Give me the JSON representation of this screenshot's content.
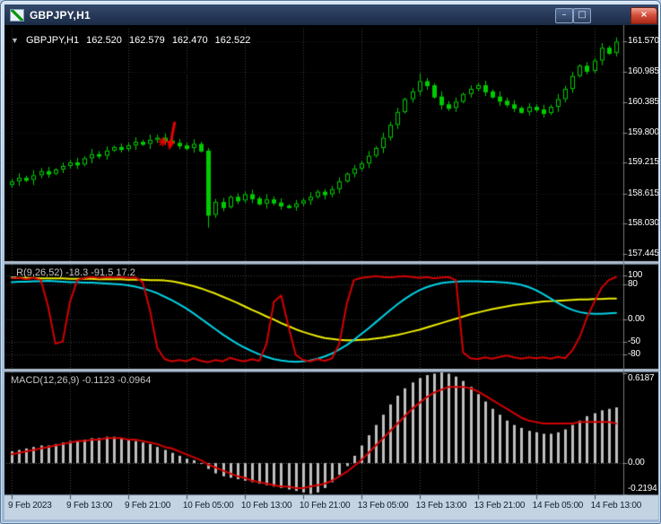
{
  "window": {
    "title": "GBPJPY,H1",
    "controls": {
      "minimize": "–",
      "restore": "□",
      "close": "×"
    }
  },
  "info_line": {
    "marker": "▼",
    "symbol": "GBPJPY,H1",
    "open": "162.520",
    "high": "162.579",
    "low": "162.470",
    "close": "162.522"
  },
  "oscillator": {
    "label": "_R(9,26,52) -18.3 -91.5 17.2"
  },
  "macd": {
    "label": "MACD(12,26,9) -0.1123 -0.0964"
  },
  "colors": {
    "bull": "#00CC00",
    "bear": "#00CC00",
    "osc_red": "#D40000",
    "osc_cyan": "#00D2E6",
    "osc_yellow": "#EDED00",
    "hist": "#BEBEBE",
    "signal": "#D40000",
    "annotation": "#E60000",
    "axis_text": "#FFFFFF",
    "time_text": "#10202F"
  },
  "annotations": [
    {
      "type": "arrow-down",
      "bar": 22,
      "from_price": 159.99,
      "to_price": 159.46
    },
    {
      "type": "star",
      "bar": 21,
      "price": 159.62
    }
  ],
  "chart_data": [
    {
      "type": "candlestick",
      "title": "GBPJPY,H1",
      "y_range": [
        157.3,
        161.82
      ],
      "y_ticks": [
        "161.570",
        "160.985",
        "160.385",
        "159.800",
        "159.215",
        "158.615",
        "158.030",
        "157.445"
      ],
      "x_labels": [
        [
          0,
          "9 Feb 2023"
        ],
        [
          8,
          "9 Feb 13:00"
        ],
        [
          16,
          "9 Feb 21:00"
        ],
        [
          24,
          "10 Feb 05:00"
        ],
        [
          32,
          "10 Feb 13:00"
        ],
        [
          40,
          "10 Feb 21:00"
        ],
        [
          48,
          "13 Feb 05:00"
        ],
        [
          56,
          "13 Feb 13:00"
        ],
        [
          64,
          "13 Feb 21:00"
        ],
        [
          72,
          "14 Feb 05:00"
        ],
        [
          80,
          "14 Feb 13:00"
        ]
      ],
      "ohlc": [
        [
          158.78,
          158.9,
          158.73,
          158.85
        ],
        [
          158.85,
          159.01,
          158.76,
          158.92
        ],
        [
          158.92,
          158.96,
          158.84,
          158.88
        ],
        [
          158.88,
          159.07,
          158.78,
          158.97
        ],
        [
          158.97,
          159.11,
          158.91,
          159.05
        ],
        [
          159.05,
          159.13,
          158.92,
          159.0
        ],
        [
          159.0,
          159.11,
          158.97,
          159.08
        ],
        [
          159.08,
          159.22,
          159.01,
          159.15
        ],
        [
          159.15,
          159.27,
          159.1,
          159.22
        ],
        [
          159.22,
          159.31,
          159.09,
          159.18
        ],
        [
          159.18,
          159.34,
          159.14,
          159.3
        ],
        [
          159.3,
          159.48,
          159.2,
          159.38
        ],
        [
          159.38,
          159.44,
          159.29,
          159.35
        ],
        [
          159.35,
          159.53,
          159.27,
          159.45
        ],
        [
          159.45,
          159.55,
          159.42,
          159.52
        ],
        [
          159.52,
          159.59,
          159.41,
          159.48
        ],
        [
          159.48,
          159.6,
          159.43,
          159.55
        ],
        [
          159.55,
          159.71,
          159.46,
          159.62
        ],
        [
          159.62,
          159.66,
          159.54,
          159.58
        ],
        [
          159.58,
          159.76,
          159.48,
          159.66
        ],
        [
          159.66,
          159.76,
          159.6,
          159.7
        ],
        [
          159.7,
          159.78,
          159.56,
          159.64
        ],
        [
          159.64,
          159.67,
          159.57,
          159.6
        ],
        [
          159.6,
          159.67,
          159.48,
          159.55
        ],
        [
          159.55,
          159.6,
          159.45,
          159.5
        ],
        [
          159.5,
          159.67,
          159.41,
          159.58
        ],
        [
          159.58,
          159.62,
          159.41,
          159.45
        ],
        [
          159.45,
          159.5,
          157.95,
          158.2
        ],
        [
          158.2,
          158.51,
          158.14,
          158.45
        ],
        [
          158.45,
          158.53,
          158.27,
          158.35
        ],
        [
          158.35,
          158.58,
          158.32,
          158.55
        ],
        [
          158.55,
          158.62,
          158.41,
          158.48
        ],
        [
          158.48,
          158.65,
          158.43,
          158.6
        ],
        [
          158.6,
          158.69,
          158.43,
          158.52
        ],
        [
          158.52,
          158.56,
          158.38,
          158.42
        ],
        [
          158.42,
          158.6,
          158.32,
          158.5
        ],
        [
          158.5,
          158.56,
          158.38,
          158.44
        ],
        [
          158.44,
          158.52,
          158.3,
          158.38
        ],
        [
          158.38,
          158.41,
          158.32,
          158.35
        ],
        [
          158.35,
          158.49,
          158.28,
          158.42
        ],
        [
          158.42,
          158.53,
          158.37,
          158.48
        ],
        [
          158.48,
          158.64,
          158.39,
          158.55
        ],
        [
          158.55,
          158.69,
          158.51,
          158.65
        ],
        [
          158.65,
          158.7,
          158.5,
          158.6
        ],
        [
          158.6,
          158.76,
          158.54,
          158.7
        ],
        [
          158.7,
          158.93,
          158.62,
          158.85
        ],
        [
          158.85,
          159.03,
          158.82,
          159.0
        ],
        [
          159.0,
          159.17,
          158.93,
          159.1
        ],
        [
          159.1,
          159.25,
          159.05,
          159.2
        ],
        [
          159.2,
          159.44,
          159.11,
          159.35
        ],
        [
          159.35,
          159.54,
          159.31,
          159.5
        ],
        [
          159.5,
          159.8,
          159.4,
          159.7
        ],
        [
          159.7,
          160.01,
          159.64,
          159.95
        ],
        [
          159.95,
          160.28,
          159.87,
          160.2
        ],
        [
          160.2,
          160.48,
          160.17,
          160.45
        ],
        [
          160.45,
          160.67,
          160.38,
          160.6
        ],
        [
          160.6,
          160.95,
          160.52,
          160.8
        ],
        [
          160.8,
          160.86,
          160.63,
          160.72
        ],
        [
          160.72,
          160.76,
          160.46,
          160.5
        ],
        [
          160.5,
          160.6,
          160.25,
          160.35
        ],
        [
          160.35,
          160.41,
          160.22,
          160.28
        ],
        [
          160.28,
          160.48,
          160.2,
          160.4
        ],
        [
          160.4,
          160.58,
          160.37,
          160.55
        ],
        [
          160.55,
          160.72,
          160.48,
          160.65
        ],
        [
          160.65,
          160.77,
          160.6,
          160.72
        ],
        [
          160.72,
          160.81,
          160.51,
          160.6
        ],
        [
          160.6,
          160.64,
          160.46,
          160.5
        ],
        [
          160.5,
          160.6,
          160.32,
          160.42
        ],
        [
          160.42,
          160.48,
          160.29,
          160.35
        ],
        [
          160.35,
          160.43,
          160.2,
          160.28
        ],
        [
          160.28,
          160.31,
          160.17,
          160.2
        ],
        [
          160.2,
          160.37,
          160.13,
          160.3
        ],
        [
          160.3,
          160.35,
          160.2,
          160.25
        ],
        [
          160.25,
          160.34,
          160.09,
          160.18
        ],
        [
          160.18,
          160.34,
          160.14,
          160.3
        ],
        [
          160.3,
          160.55,
          160.2,
          160.45
        ],
        [
          160.45,
          160.71,
          160.39,
          160.65
        ],
        [
          160.65,
          160.98,
          160.57,
          160.9
        ],
        [
          160.9,
          161.13,
          160.87,
          161.1
        ],
        [
          161.1,
          161.17,
          160.93,
          161.0
        ],
        [
          161.0,
          161.25,
          160.95,
          161.2
        ],
        [
          161.2,
          161.54,
          161.11,
          161.45
        ],
        [
          161.45,
          161.49,
          161.31,
          161.35
        ],
        [
          161.35,
          161.65,
          161.28,
          161.57
        ]
      ]
    },
    {
      "type": "line",
      "title": "_R(9,26,52)",
      "y_range": [
        -112,
        125
      ],
      "y_ticks": [
        "100",
        "80",
        "0.00",
        "-50",
        "-80"
      ],
      "series": [
        {
          "name": "fast",
          "color_key": "osc_red",
          "values": [
            95,
            95,
            92,
            95,
            90,
            30,
            -55,
            -50,
            40,
            90,
            95,
            97,
            95,
            97,
            96,
            97,
            95,
            96,
            85,
            20,
            -65,
            -90,
            -95,
            -92,
            -95,
            -88,
            -94,
            -97,
            -92,
            -95,
            -87,
            -92,
            -95,
            -90,
            -94,
            -55,
            40,
            55,
            -15,
            -80,
            -92,
            -95,
            -90,
            -94,
            -88,
            -55,
            35,
            90,
            95,
            97,
            99,
            97,
            96,
            98,
            99,
            97,
            95,
            97,
            94,
            96,
            97,
            90,
            -75,
            -88,
            -90,
            -86,
            -89,
            -85,
            -82,
            -86,
            -89,
            -86,
            -88,
            -86,
            -89,
            -85,
            -88,
            -70,
            -40,
            5,
            40,
            72,
            90,
            97
          ]
        },
        {
          "name": "mid",
          "color_key": "osc_cyan",
          "values": [
            85,
            86,
            86,
            87,
            87,
            88,
            87,
            86,
            85,
            85,
            84,
            84,
            83,
            82,
            81,
            80,
            78,
            75,
            71,
            66,
            60,
            52,
            44,
            35,
            25,
            14,
            2,
            -10,
            -22,
            -34,
            -45,
            -55,
            -64,
            -72,
            -79,
            -85,
            -90,
            -93,
            -95,
            -96,
            -95,
            -93,
            -89,
            -84,
            -77,
            -68,
            -58,
            -46,
            -33,
            -20,
            -6,
            8,
            22,
            35,
            47,
            58,
            67,
            74,
            79,
            83,
            85,
            86,
            87,
            87,
            87,
            86,
            86,
            85,
            84,
            82,
            79,
            74,
            67,
            58,
            48,
            38,
            29,
            22,
            17,
            14,
            13,
            13,
            14,
            15
          ]
        },
        {
          "name": "slow",
          "color_key": "osc_yellow",
          "values": [
            95,
            95,
            95,
            95,
            94,
            94,
            94,
            94,
            93,
            93,
            93,
            93,
            92,
            92,
            92,
            92,
            91,
            91,
            91,
            90,
            90,
            89,
            87,
            84,
            80,
            76,
            71,
            65,
            59,
            52,
            45,
            38,
            30,
            22,
            15,
            7,
            0,
            -8,
            -15,
            -22,
            -28,
            -33,
            -38,
            -42,
            -44,
            -46,
            -47,
            -47,
            -46,
            -45,
            -43,
            -41,
            -38,
            -35,
            -31,
            -27,
            -23,
            -18,
            -13,
            -8,
            -3,
            2,
            7,
            12,
            16,
            20,
            24,
            27,
            30,
            33,
            35,
            37,
            39,
            41,
            42,
            43,
            44,
            45,
            46,
            46,
            47,
            47,
            48,
            48
          ]
        }
      ]
    },
    {
      "type": "macd",
      "title": "MACD(12,26,9)",
      "y_range": [
        -0.2194,
        0.6187
      ],
      "y_ticks": [
        "0.6187",
        "0.00",
        "-0.2194"
      ],
      "histogram": [
        0.08,
        0.09,
        0.1,
        0.11,
        0.12,
        0.12,
        0.13,
        0.14,
        0.15,
        0.15,
        0.16,
        0.17,
        0.17,
        0.18,
        0.18,
        0.17,
        0.16,
        0.15,
        0.14,
        0.13,
        0.11,
        0.09,
        0.07,
        0.05,
        0.03,
        0.02,
        0.0,
        -0.04,
        -0.07,
        -0.09,
        -0.1,
        -0.11,
        -0.12,
        -0.13,
        -0.14,
        -0.15,
        -0.16,
        -0.17,
        -0.18,
        -0.19,
        -0.2,
        -0.21,
        -0.2,
        -0.17,
        -0.13,
        -0.08,
        -0.02,
        0.05,
        0.12,
        0.19,
        0.26,
        0.33,
        0.4,
        0.46,
        0.51,
        0.55,
        0.58,
        0.6,
        0.61,
        0.62,
        0.61,
        0.59,
        0.56,
        0.52,
        0.47,
        0.42,
        0.37,
        0.33,
        0.29,
        0.26,
        0.24,
        0.22,
        0.21,
        0.2,
        0.2,
        0.21,
        0.23,
        0.26,
        0.29,
        0.32,
        0.34,
        0.36,
        0.37,
        0.38
      ],
      "signal": [
        0.06,
        0.07,
        0.08,
        0.09,
        0.1,
        0.11,
        0.12,
        0.13,
        0.14,
        0.15,
        0.15,
        0.16,
        0.16,
        0.17,
        0.17,
        0.17,
        0.16,
        0.16,
        0.15,
        0.14,
        0.13,
        0.11,
        0.1,
        0.08,
        0.06,
        0.04,
        0.02,
        -0.01,
        -0.03,
        -0.05,
        -0.07,
        -0.09,
        -0.1,
        -0.12,
        -0.13,
        -0.14,
        -0.15,
        -0.16,
        -0.16,
        -0.17,
        -0.17,
        -0.16,
        -0.15,
        -0.14,
        -0.12,
        -0.09,
        -0.06,
        -0.02,
        0.02,
        0.07,
        0.12,
        0.17,
        0.22,
        0.27,
        0.32,
        0.37,
        0.41,
        0.45,
        0.48,
        0.5,
        0.52,
        0.52,
        0.52,
        0.51,
        0.49,
        0.46,
        0.43,
        0.4,
        0.37,
        0.34,
        0.31,
        0.29,
        0.28,
        0.27,
        0.27,
        0.27,
        0.27,
        0.27,
        0.28,
        0.28,
        0.28,
        0.28,
        0.28,
        0.27
      ]
    }
  ]
}
